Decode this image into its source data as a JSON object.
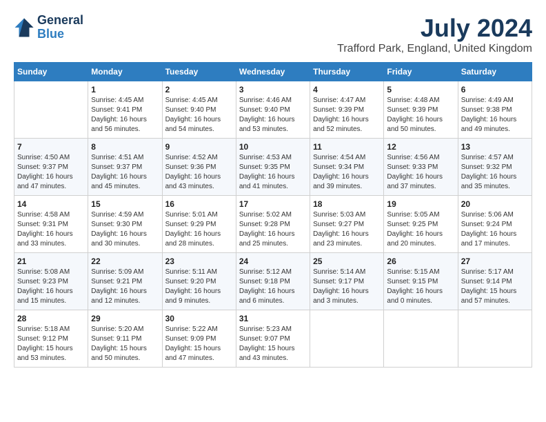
{
  "header": {
    "logo_line1": "General",
    "logo_line2": "Blue",
    "month_year": "July 2024",
    "location": "Trafford Park, England, United Kingdom"
  },
  "days_of_week": [
    "Sunday",
    "Monday",
    "Tuesday",
    "Wednesday",
    "Thursday",
    "Friday",
    "Saturday"
  ],
  "weeks": [
    [
      {
        "day": "",
        "sunrise": "",
        "sunset": "",
        "daylight": ""
      },
      {
        "day": "1",
        "sunrise": "Sunrise: 4:45 AM",
        "sunset": "Sunset: 9:41 PM",
        "daylight": "Daylight: 16 hours and 56 minutes."
      },
      {
        "day": "2",
        "sunrise": "Sunrise: 4:45 AM",
        "sunset": "Sunset: 9:40 PM",
        "daylight": "Daylight: 16 hours and 54 minutes."
      },
      {
        "day": "3",
        "sunrise": "Sunrise: 4:46 AM",
        "sunset": "Sunset: 9:40 PM",
        "daylight": "Daylight: 16 hours and 53 minutes."
      },
      {
        "day": "4",
        "sunrise": "Sunrise: 4:47 AM",
        "sunset": "Sunset: 9:39 PM",
        "daylight": "Daylight: 16 hours and 52 minutes."
      },
      {
        "day": "5",
        "sunrise": "Sunrise: 4:48 AM",
        "sunset": "Sunset: 9:39 PM",
        "daylight": "Daylight: 16 hours and 50 minutes."
      },
      {
        "day": "6",
        "sunrise": "Sunrise: 4:49 AM",
        "sunset": "Sunset: 9:38 PM",
        "daylight": "Daylight: 16 hours and 49 minutes."
      }
    ],
    [
      {
        "day": "7",
        "sunrise": "Sunrise: 4:50 AM",
        "sunset": "Sunset: 9:37 PM",
        "daylight": "Daylight: 16 hours and 47 minutes."
      },
      {
        "day": "8",
        "sunrise": "Sunrise: 4:51 AM",
        "sunset": "Sunset: 9:37 PM",
        "daylight": "Daylight: 16 hours and 45 minutes."
      },
      {
        "day": "9",
        "sunrise": "Sunrise: 4:52 AM",
        "sunset": "Sunset: 9:36 PM",
        "daylight": "Daylight: 16 hours and 43 minutes."
      },
      {
        "day": "10",
        "sunrise": "Sunrise: 4:53 AM",
        "sunset": "Sunset: 9:35 PM",
        "daylight": "Daylight: 16 hours and 41 minutes."
      },
      {
        "day": "11",
        "sunrise": "Sunrise: 4:54 AM",
        "sunset": "Sunset: 9:34 PM",
        "daylight": "Daylight: 16 hours and 39 minutes."
      },
      {
        "day": "12",
        "sunrise": "Sunrise: 4:56 AM",
        "sunset": "Sunset: 9:33 PM",
        "daylight": "Daylight: 16 hours and 37 minutes."
      },
      {
        "day": "13",
        "sunrise": "Sunrise: 4:57 AM",
        "sunset": "Sunset: 9:32 PM",
        "daylight": "Daylight: 16 hours and 35 minutes."
      }
    ],
    [
      {
        "day": "14",
        "sunrise": "Sunrise: 4:58 AM",
        "sunset": "Sunset: 9:31 PM",
        "daylight": "Daylight: 16 hours and 33 minutes."
      },
      {
        "day": "15",
        "sunrise": "Sunrise: 4:59 AM",
        "sunset": "Sunset: 9:30 PM",
        "daylight": "Daylight: 16 hours and 30 minutes."
      },
      {
        "day": "16",
        "sunrise": "Sunrise: 5:01 AM",
        "sunset": "Sunset: 9:29 PM",
        "daylight": "Daylight: 16 hours and 28 minutes."
      },
      {
        "day": "17",
        "sunrise": "Sunrise: 5:02 AM",
        "sunset": "Sunset: 9:28 PM",
        "daylight": "Daylight: 16 hours and 25 minutes."
      },
      {
        "day": "18",
        "sunrise": "Sunrise: 5:03 AM",
        "sunset": "Sunset: 9:27 PM",
        "daylight": "Daylight: 16 hours and 23 minutes."
      },
      {
        "day": "19",
        "sunrise": "Sunrise: 5:05 AM",
        "sunset": "Sunset: 9:25 PM",
        "daylight": "Daylight: 16 hours and 20 minutes."
      },
      {
        "day": "20",
        "sunrise": "Sunrise: 5:06 AM",
        "sunset": "Sunset: 9:24 PM",
        "daylight": "Daylight: 16 hours and 17 minutes."
      }
    ],
    [
      {
        "day": "21",
        "sunrise": "Sunrise: 5:08 AM",
        "sunset": "Sunset: 9:23 PM",
        "daylight": "Daylight: 16 hours and 15 minutes."
      },
      {
        "day": "22",
        "sunrise": "Sunrise: 5:09 AM",
        "sunset": "Sunset: 9:21 PM",
        "daylight": "Daylight: 16 hours and 12 minutes."
      },
      {
        "day": "23",
        "sunrise": "Sunrise: 5:11 AM",
        "sunset": "Sunset: 9:20 PM",
        "daylight": "Daylight: 16 hours and 9 minutes."
      },
      {
        "day": "24",
        "sunrise": "Sunrise: 5:12 AM",
        "sunset": "Sunset: 9:18 PM",
        "daylight": "Daylight: 16 hours and 6 minutes."
      },
      {
        "day": "25",
        "sunrise": "Sunrise: 5:14 AM",
        "sunset": "Sunset: 9:17 PM",
        "daylight": "Daylight: 16 hours and 3 minutes."
      },
      {
        "day": "26",
        "sunrise": "Sunrise: 5:15 AM",
        "sunset": "Sunset: 9:15 PM",
        "daylight": "Daylight: 16 hours and 0 minutes."
      },
      {
        "day": "27",
        "sunrise": "Sunrise: 5:17 AM",
        "sunset": "Sunset: 9:14 PM",
        "daylight": "Daylight: 15 hours and 57 minutes."
      }
    ],
    [
      {
        "day": "28",
        "sunrise": "Sunrise: 5:18 AM",
        "sunset": "Sunset: 9:12 PM",
        "daylight": "Daylight: 15 hours and 53 minutes."
      },
      {
        "day": "29",
        "sunrise": "Sunrise: 5:20 AM",
        "sunset": "Sunset: 9:11 PM",
        "daylight": "Daylight: 15 hours and 50 minutes."
      },
      {
        "day": "30",
        "sunrise": "Sunrise: 5:22 AM",
        "sunset": "Sunset: 9:09 PM",
        "daylight": "Daylight: 15 hours and 47 minutes."
      },
      {
        "day": "31",
        "sunrise": "Sunrise: 5:23 AM",
        "sunset": "Sunset: 9:07 PM",
        "daylight": "Daylight: 15 hours and 43 minutes."
      },
      {
        "day": "",
        "sunrise": "",
        "sunset": "",
        "daylight": ""
      },
      {
        "day": "",
        "sunrise": "",
        "sunset": "",
        "daylight": ""
      },
      {
        "day": "",
        "sunrise": "",
        "sunset": "",
        "daylight": ""
      }
    ]
  ]
}
